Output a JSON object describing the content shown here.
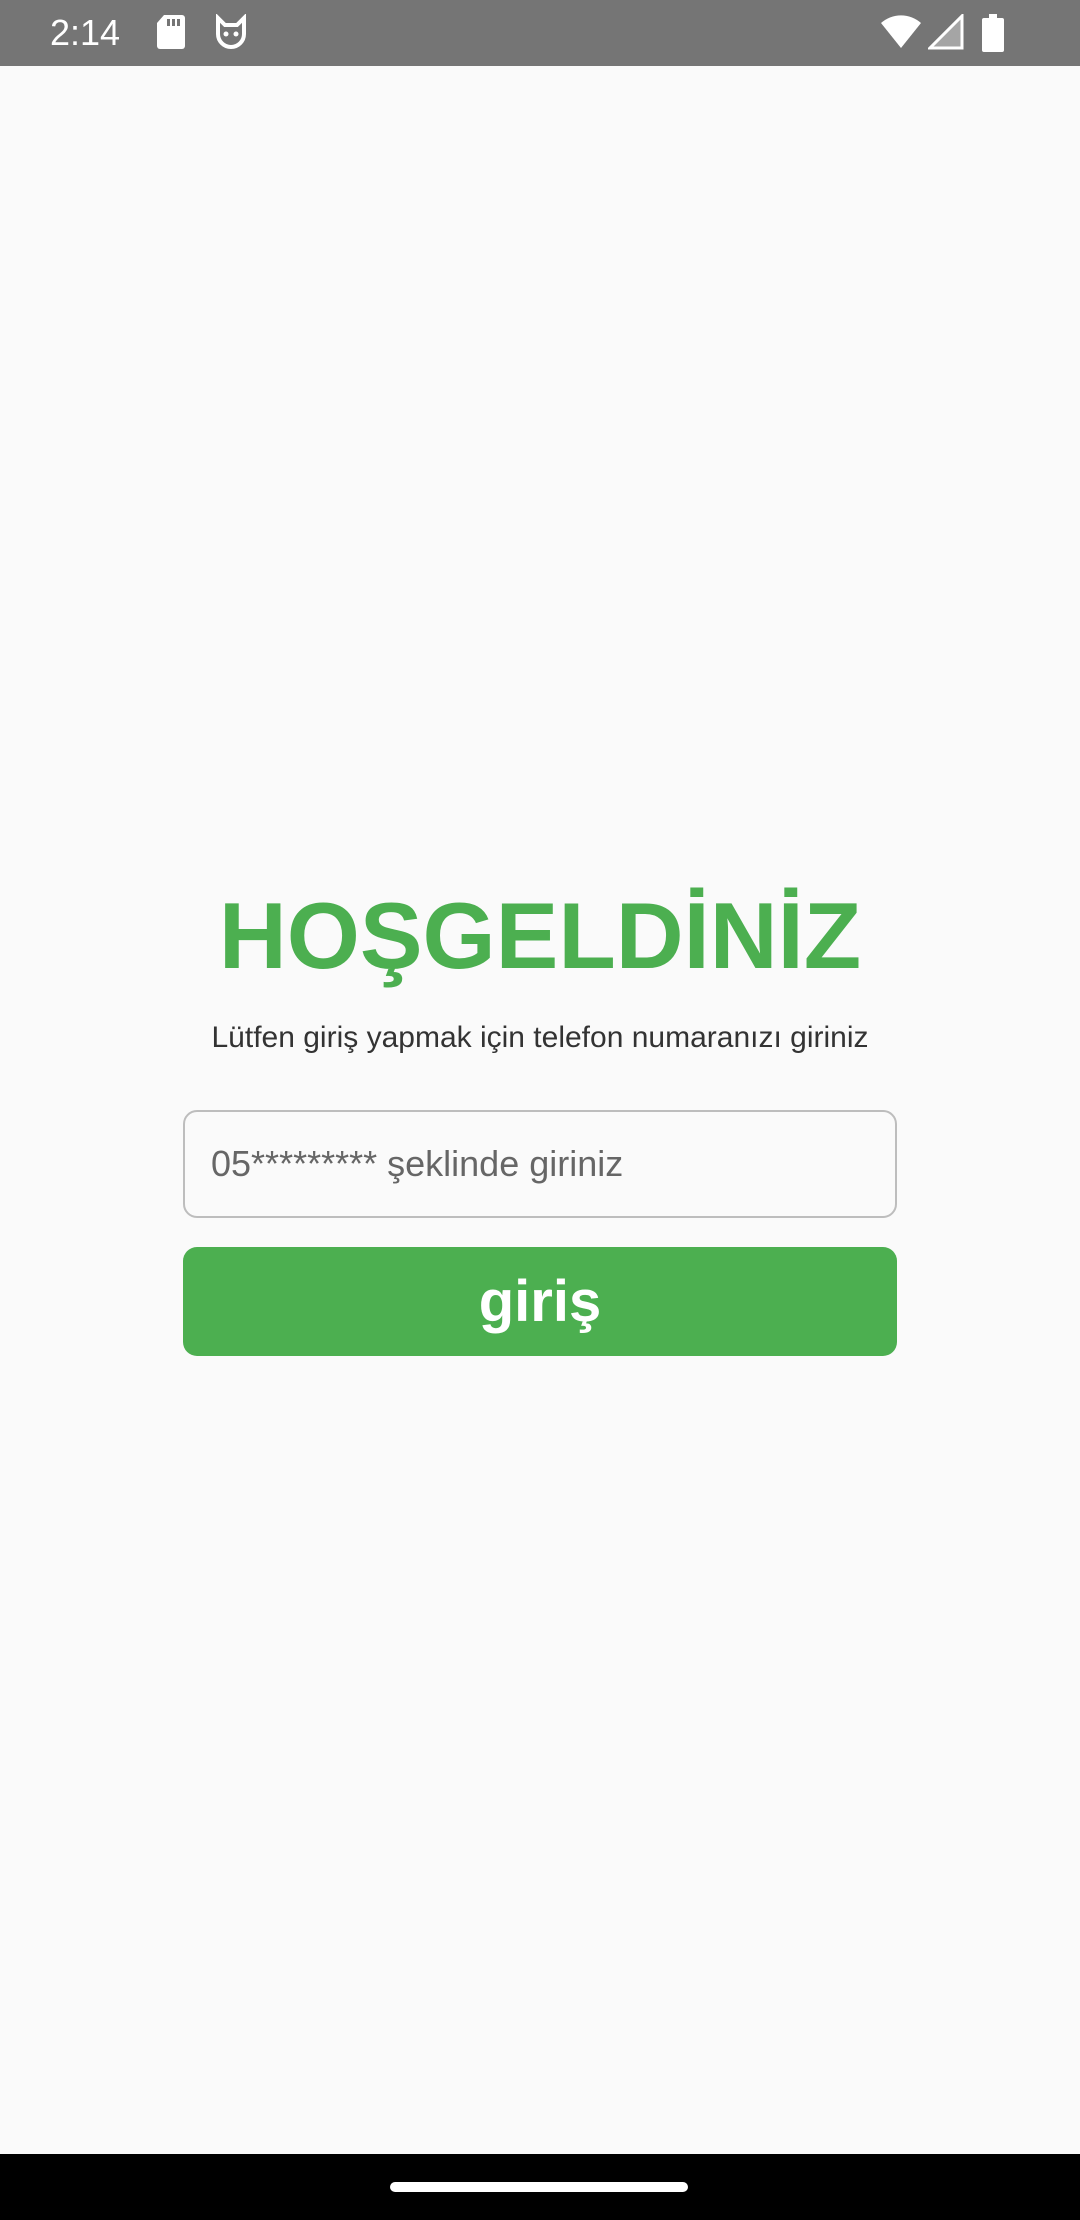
{
  "status_bar": {
    "time": "2:14",
    "icons": [
      "sd-card-icon",
      "cat-icon",
      "wifi-icon",
      "signal-icon",
      "battery-icon"
    ]
  },
  "login": {
    "title": "HOŞGELDİNİZ",
    "subtitle": "Lütfen giriş yapmak için telefon numaranızı giriniz",
    "phone_placeholder": "05********* şeklinde giriniz",
    "phone_value": "",
    "button_label": "giriş"
  },
  "colors": {
    "accent": "#4caf50",
    "status_bar": "#757575",
    "background": "#fafafa",
    "nav_bar": "#000000"
  }
}
